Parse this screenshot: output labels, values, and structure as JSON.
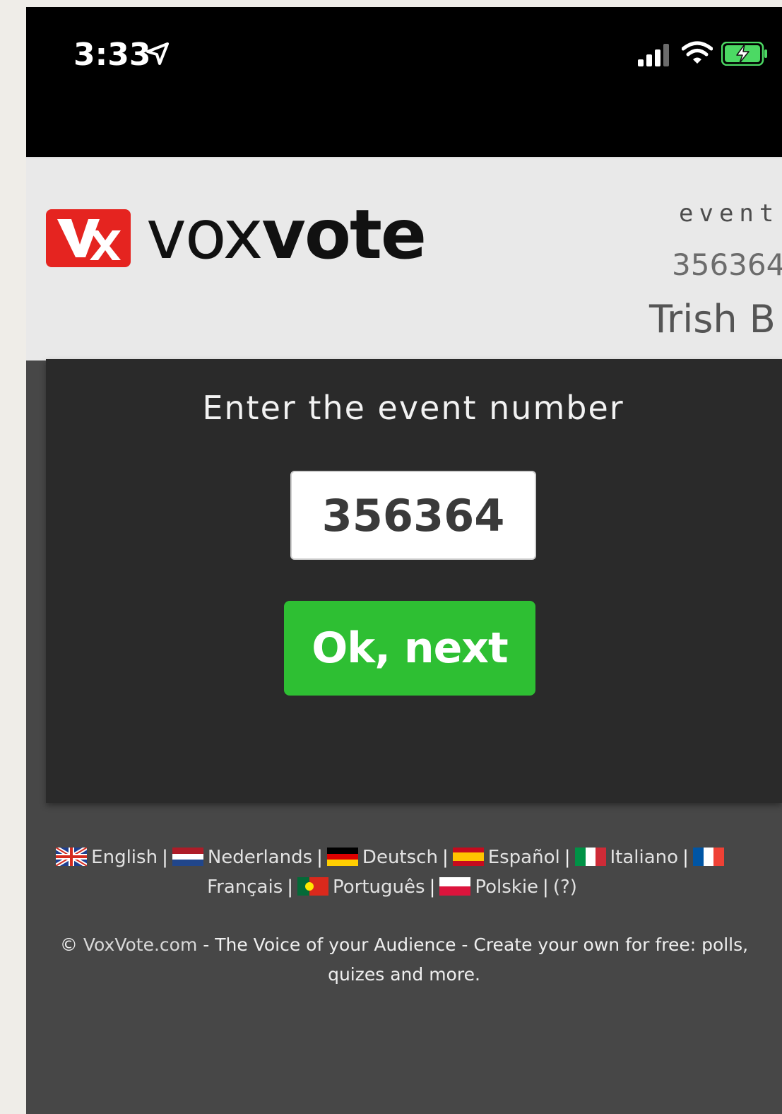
{
  "status_bar": {
    "time": "3:33",
    "icons": [
      "location-arrow-icon",
      "cellular-signal-icon",
      "wifi-icon",
      "battery-charging-icon"
    ]
  },
  "header": {
    "brand_vox": "vox",
    "brand_vote": "vote",
    "event_label": "event",
    "event_number": "356364",
    "user_name": "Trish B"
  },
  "main": {
    "prompt": "Enter the event number",
    "event_input_value": "356364",
    "ok_button_label": "Ok, next"
  },
  "languages": [
    {
      "label": "English",
      "flag": "uk-flag-icon"
    },
    {
      "label": "Nederlands",
      "flag": "netherlands-flag-icon"
    },
    {
      "label": "Deutsch",
      "flag": "germany-flag-icon"
    },
    {
      "label": "Español",
      "flag": "spain-flag-icon"
    },
    {
      "label": "Italiano",
      "flag": "italy-flag-icon"
    },
    {
      "label": "Français",
      "flag": "france-flag-icon"
    },
    {
      "label": "Português",
      "flag": "portugal-flag-icon"
    },
    {
      "label": "Polskie",
      "flag": "poland-flag-icon"
    }
  ],
  "language_help": "(?)",
  "separator": "|",
  "footer": {
    "copyright_symbol": "©",
    "site_link": "VoxVote.com",
    "tagline": " - The Voice of your Audience - Create your own for free: polls,",
    "tagline_cont": "quizes and more."
  },
  "colors": {
    "status_bar": "#000000",
    "header_bg": "#e9e9e9",
    "panel_bg": "#2a2a2a",
    "page_bg": "#474747",
    "logo_red": "#e52420",
    "ok_button_green": "#2ebf33",
    "battery_green": "#4cd964"
  }
}
